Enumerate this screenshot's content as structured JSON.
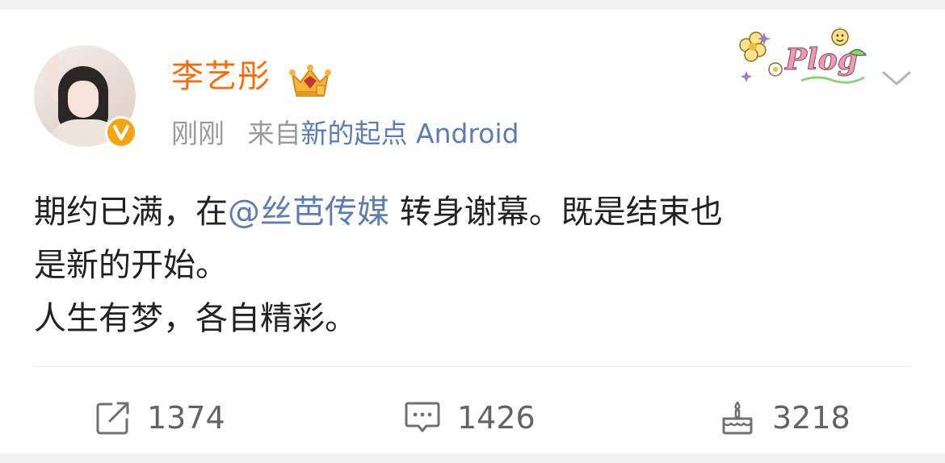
{
  "post": {
    "author": {
      "name": "李艺彤",
      "verified_icon": "v-badge-icon",
      "member_icon": "crown-icon"
    },
    "time": "刚刚",
    "source_prefix": "来自",
    "source_app": "新的起点 Android",
    "decoration_sticker": "Plog",
    "content": {
      "line1_pre": "期约已满，在",
      "mention": "@丝芭传媒",
      "line1_post": " 转身谢幕。既是结束也",
      "line2": "是新的开始。",
      "line3": "人生有梦，各自精彩。"
    },
    "actions": {
      "share_count": "1374",
      "comment_count": "1426",
      "like_count": "3218"
    }
  },
  "colors": {
    "username": "#f86d0b",
    "link": "#5d7bb5",
    "meta": "#9a9a9a",
    "text": "#222222",
    "badge": "#f7a50f"
  }
}
